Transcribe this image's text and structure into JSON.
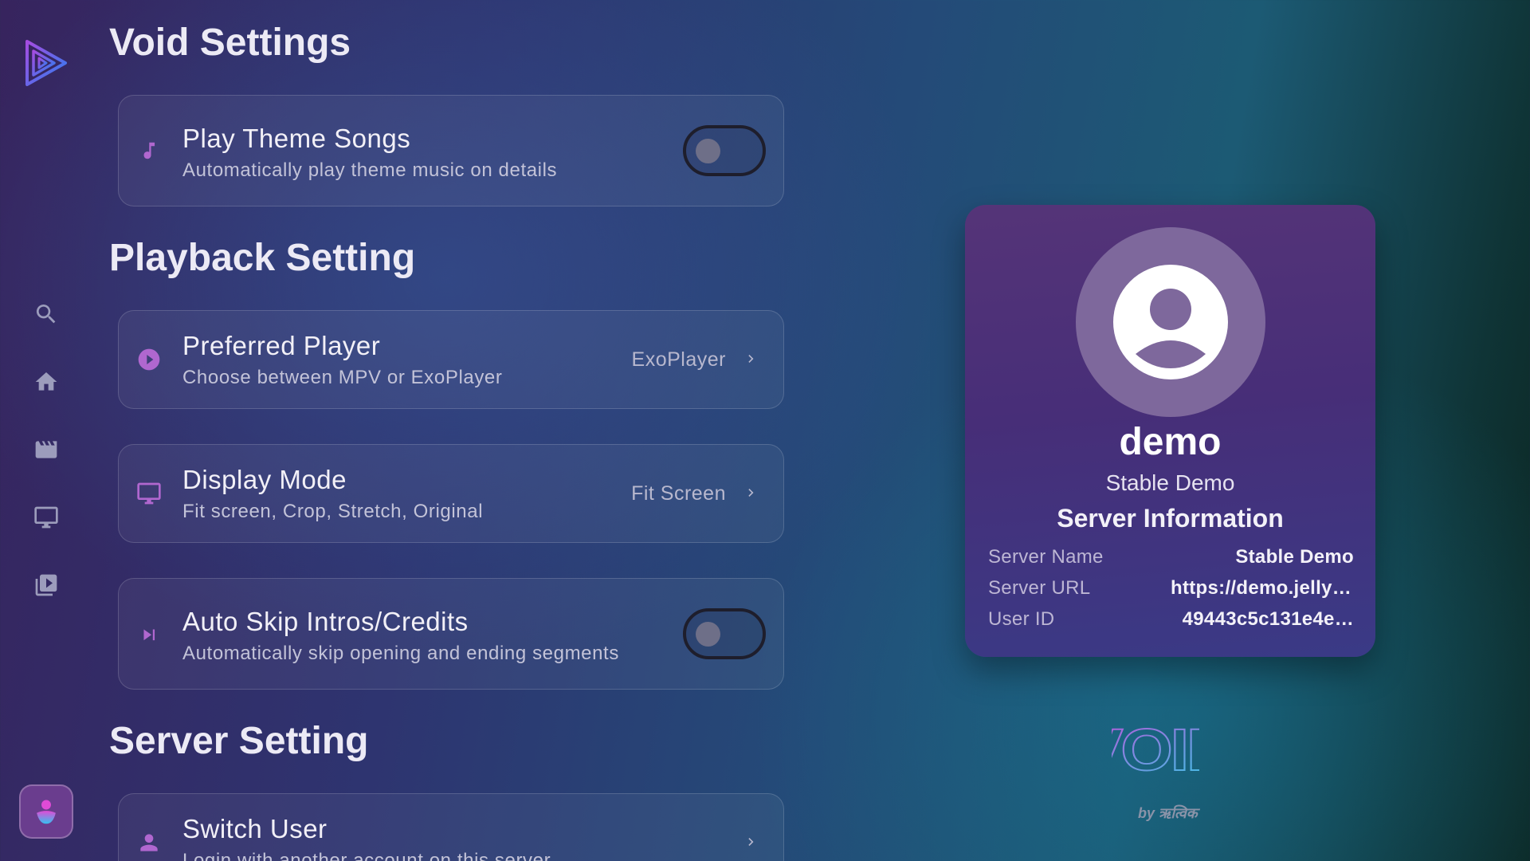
{
  "sidebar": {
    "items": [
      {
        "name": "search",
        "icon": "search-icon"
      },
      {
        "name": "home",
        "icon": "home-icon"
      },
      {
        "name": "movies",
        "icon": "movie-icon"
      },
      {
        "name": "tv",
        "icon": "tv-icon"
      },
      {
        "name": "library",
        "icon": "video-library-icon"
      }
    ],
    "profile_icon": "user-icon"
  },
  "sections": {
    "void": {
      "title": "Void Settings"
    },
    "playback": {
      "title": "Playback Setting"
    },
    "server": {
      "title": "Server Setting"
    }
  },
  "settings": {
    "theme_songs": {
      "title": "Play Theme Songs",
      "subtitle": "Automatically play theme music on details",
      "icon": "music-note-icon",
      "enabled": false
    },
    "preferred_player": {
      "title": "Preferred Player",
      "subtitle": "Choose between MPV or ExoPlayer",
      "value": "ExoPlayer",
      "icon": "play-circle-icon"
    },
    "display_mode": {
      "title": "Display Mode",
      "subtitle": "Fit screen, Crop, Stretch, Original",
      "value": "Fit Screen",
      "icon": "monitor-icon"
    },
    "auto_skip": {
      "title": "Auto Skip Intros/Credits",
      "subtitle": "Automatically skip opening and ending segments",
      "icon": "skip-next-icon",
      "enabled": false
    },
    "switch_user": {
      "title": "Switch User",
      "subtitle": "Login with another account on this server",
      "icon": "person-icon"
    }
  },
  "profile": {
    "username": "demo",
    "server_label": "Stable Demo",
    "info_title": "Server Information",
    "rows": [
      {
        "key": "Server Name",
        "value": "Stable Demo"
      },
      {
        "key": "Server URL",
        "value": "https://demo.jellyf…"
      },
      {
        "key": "User ID",
        "value": "49443c5c131e4e…"
      }
    ]
  },
  "brand": {
    "logo_text": "VOID",
    "byline": "by ऋत्विक"
  },
  "colors": {
    "accent": "#b067cf",
    "toggle_off": "#6e6f88",
    "card_bg": "#472e78"
  }
}
